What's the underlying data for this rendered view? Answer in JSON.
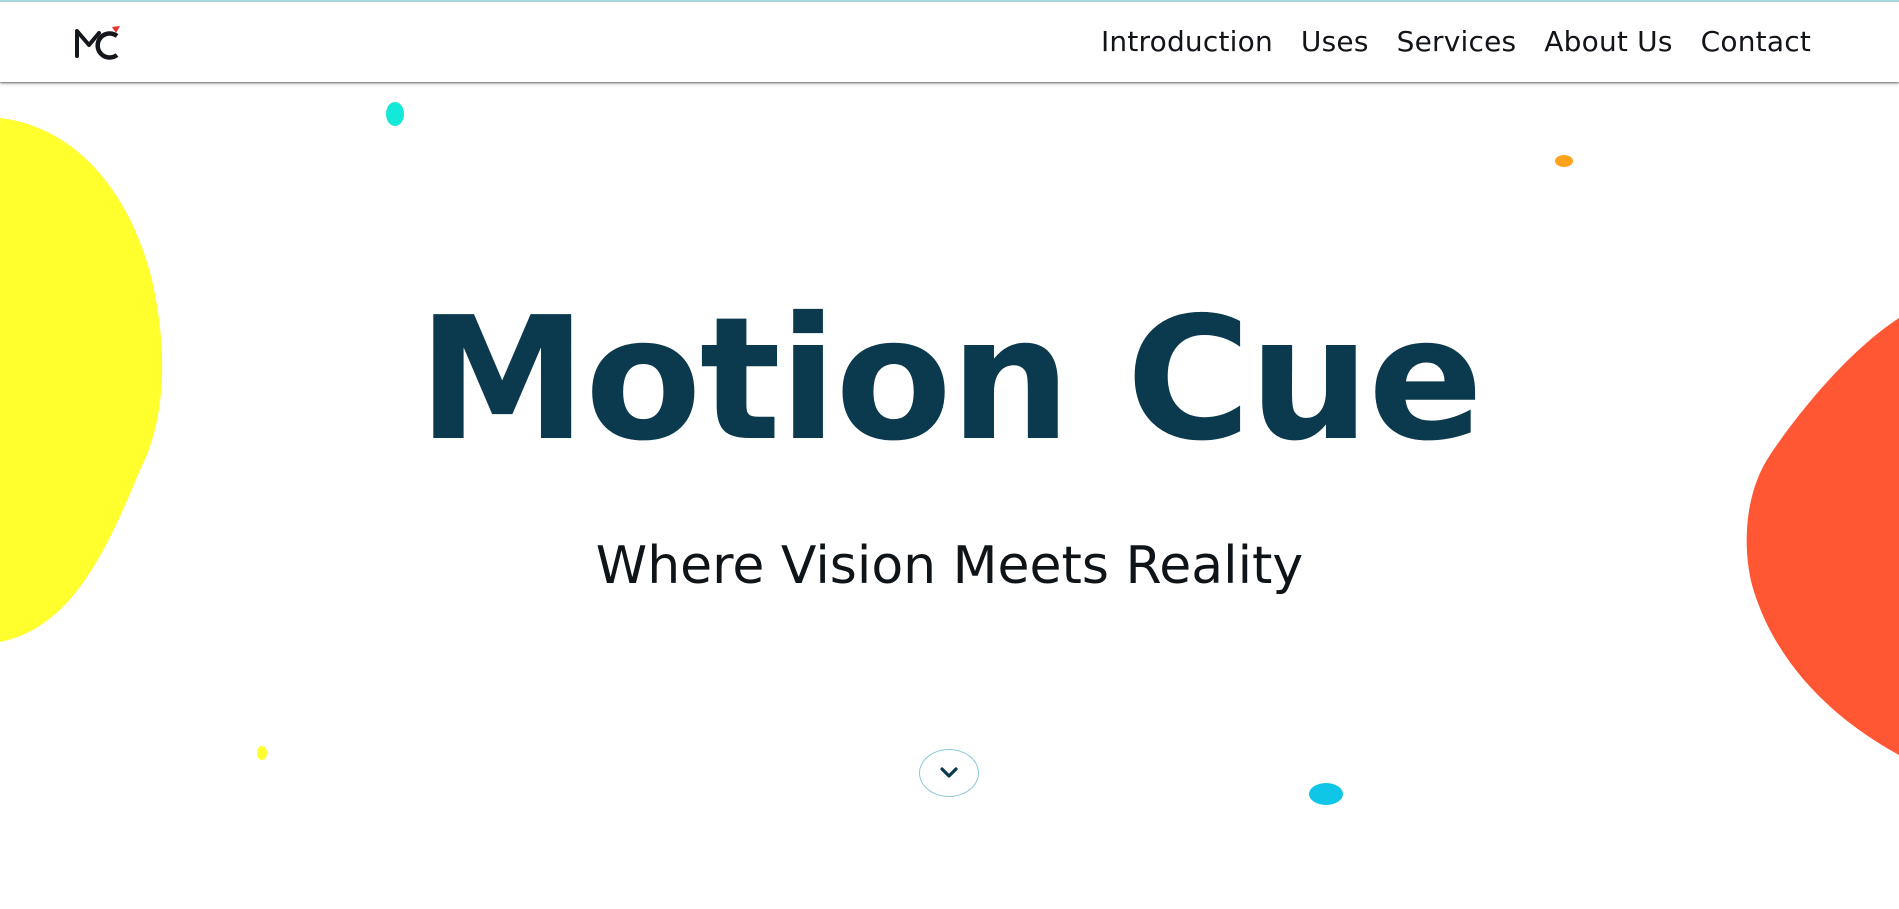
{
  "header": {
    "logo_text": "MC",
    "nav": [
      {
        "label": "Introduction"
      },
      {
        "label": "Uses"
      },
      {
        "label": "Services"
      },
      {
        "label": "About Us"
      },
      {
        "label": "Contact"
      }
    ]
  },
  "hero": {
    "title": "Motion Cue",
    "subtitle": "Where Vision Meets Reality",
    "scroll_icon": "chevron-down-icon"
  },
  "colors": {
    "title": "#0b3a4e",
    "yellow_blob": "#ffff2e",
    "orange_blob": "#ff5733",
    "cyan_dot": "#14e8d8",
    "blue_dot": "#0fc6e6",
    "amber_dot": "#ffa31a",
    "logo_accent": "#e8302a"
  }
}
